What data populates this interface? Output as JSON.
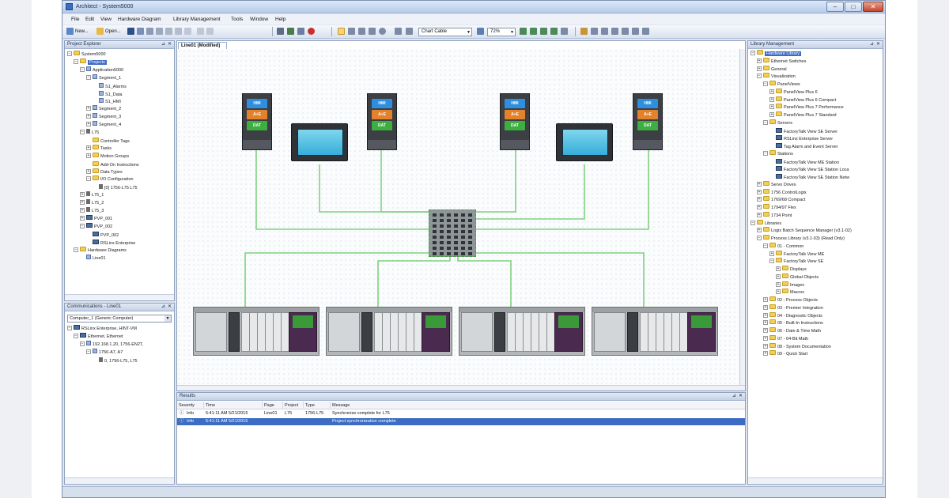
{
  "window": {
    "title": "Architect - System5000",
    "controls": {
      "minimize": "–",
      "maximize": "□",
      "close": "✕"
    }
  },
  "menu": [
    "File",
    "Edit",
    "View",
    "Hardware Diagram",
    "Library Management",
    "Tools",
    "Window",
    "Help"
  ],
  "toolbar": {
    "new_label": "New...",
    "open_label": "Open...",
    "link_style": "Chart Cable",
    "zoom": "72%"
  },
  "project_explorer": {
    "title": "Project Explorer",
    "items": [
      {
        "label": "System5000",
        "expander": "−",
        "icon": "folder-icon"
      },
      {
        "label": "Projects",
        "expander": "−",
        "icon": "folder-icon",
        "selected": true
      },
      {
        "label": "Application5000",
        "expander": "−",
        "icon": "doc-icon"
      },
      {
        "label": "Segment_1",
        "expander": "−",
        "icon": "doc-icon"
      },
      {
        "label": "S1_Alarms",
        "expander": "",
        "icon": "doc-icon"
      },
      {
        "label": "S1_Data",
        "expander": "",
        "icon": "doc-icon"
      },
      {
        "label": "S1_HMI",
        "expander": "",
        "icon": "doc-icon"
      },
      {
        "label": "Segment_2",
        "expander": "+",
        "icon": "doc-icon"
      },
      {
        "label": "Segment_3",
        "expander": "+",
        "icon": "doc-icon"
      },
      {
        "label": "Segment_4",
        "expander": "+",
        "icon": "doc-icon"
      },
      {
        "label": "L75",
        "expander": "−",
        "icon": "tag-icon"
      },
      {
        "label": "Controller Tags",
        "expander": "",
        "icon": "folder-icon"
      },
      {
        "label": "Tasks",
        "expander": "+",
        "icon": "folder-icon"
      },
      {
        "label": "Motion Groups",
        "expander": "+",
        "icon": "folder-icon"
      },
      {
        "label": "Add-On Instructions",
        "expander": "",
        "icon": "folder-icon"
      },
      {
        "label": "Data Types",
        "expander": "+",
        "icon": "folder-icon"
      },
      {
        "label": "I/O Configuration",
        "expander": "−",
        "icon": "folder-icon"
      },
      {
        "label": "[0] 1756-L75 L75",
        "expander": "",
        "icon": "tag-icon"
      },
      {
        "label": "L75_1",
        "expander": "+",
        "icon": "tag-icon"
      },
      {
        "label": "L75_2",
        "expander": "+",
        "icon": "tag-icon"
      },
      {
        "label": "L75_3",
        "expander": "+",
        "icon": "tag-icon"
      },
      {
        "label": "PVP_001",
        "expander": "+",
        "icon": "screen-icon"
      },
      {
        "label": "PVP_002",
        "expander": "−",
        "icon": "screen-icon"
      },
      {
        "label": "PVP_002",
        "expander": "",
        "icon": "screen-icon"
      },
      {
        "label": "RSLinx Enterprise",
        "expander": "",
        "icon": "screen-icon"
      },
      {
        "label": "Hardware Diagrams",
        "expander": "−",
        "icon": "folder-icon"
      },
      {
        "label": "Line01",
        "expander": "",
        "icon": "doc-icon"
      }
    ]
  },
  "communications": {
    "title": "Communications - Line01",
    "computer": "Computer_1 (Generic Computer)",
    "items": [
      {
        "label": "RSLinx Enterprise, HINT-VM",
        "expander": "−",
        "icon": "screen-icon"
      },
      {
        "label": "Ethernet, Ethernet",
        "expander": "−",
        "icon": "screen-icon"
      },
      {
        "label": "192.168.1.20, 1756-EN2T,",
        "expander": "−",
        "icon": "doc-icon"
      },
      {
        "label": "1756-A7, A7",
        "expander": "−",
        "icon": "doc-icon"
      },
      {
        "label": "0, 1756-L75, L75",
        "expander": "",
        "icon": "tag-icon"
      }
    ]
  },
  "diagram": {
    "tab": "Line01 (Modified)",
    "controller_labels": {
      "hmi": "HMI",
      "ae": "A+E",
      "dat": "DAT"
    }
  },
  "results": {
    "title": "Results",
    "columns": [
      "Severity",
      "Time",
      "Page",
      "Project",
      "Type",
      "Message"
    ],
    "rows": [
      {
        "severity": "Info",
        "time": "5:41:11 AM 5/21/2015",
        "page": "Line01",
        "project": "L75",
        "type": "1756-L75",
        "message": "Synchronize complete for L75"
      },
      {
        "severity": "Info",
        "time": "5:41:11 AM 5/21/2015",
        "page": "",
        "project": "",
        "type": "",
        "message": "Project synchronization complete"
      }
    ]
  },
  "library": {
    "title": "Library Management",
    "items": [
      {
        "label": "Hardware Library",
        "expander": "−",
        "icon": "folder-icon",
        "selected": true
      },
      {
        "label": "Ethernet Switches",
        "expander": "+",
        "icon": "folder-icon"
      },
      {
        "label": "General",
        "expander": "+",
        "icon": "folder-icon"
      },
      {
        "label": "Visualization",
        "expander": "−",
        "icon": "folder-icon"
      },
      {
        "label": "PanelViews",
        "expander": "−",
        "icon": "folder-icon"
      },
      {
        "label": "PanelView Plus 6",
        "expander": "+",
        "icon": "folder-icon"
      },
      {
        "label": "PanelView Plus 6 Compact",
        "expander": "+",
        "icon": "folder-icon"
      },
      {
        "label": "PanelView Plus 7 Performance",
        "expander": "+",
        "icon": "folder-icon"
      },
      {
        "label": "PanelView Plus 7 Standard",
        "expander": "+",
        "icon": "folder-icon"
      },
      {
        "label": "Servers",
        "expander": "−",
        "icon": "folder-icon"
      },
      {
        "label": "FactoryTalk View SE Server",
        "expander": "",
        "icon": "screen-icon"
      },
      {
        "label": "RSLinx Enterprise Server",
        "expander": "",
        "icon": "screen-icon"
      },
      {
        "label": "Tag Alarm and Event Server",
        "expander": "",
        "icon": "screen-icon"
      },
      {
        "label": "Stations",
        "expander": "−",
        "icon": "folder-icon"
      },
      {
        "label": "FactoryTalk View ME Station",
        "expander": "",
        "icon": "screen-icon"
      },
      {
        "label": "FactoryTalk View SE Station Loca",
        "expander": "",
        "icon": "screen-icon"
      },
      {
        "label": "FactoryTalk View SE Station Netw",
        "expander": "",
        "icon": "screen-icon"
      },
      {
        "label": "Servo Drives",
        "expander": "+",
        "icon": "folder-icon"
      },
      {
        "label": "1756 ControlLogix",
        "expander": "+",
        "icon": "folder-icon"
      },
      {
        "label": "1769/68 Compact",
        "expander": "+",
        "icon": "folder-icon"
      },
      {
        "label": "1794/97 Flex",
        "expander": "+",
        "icon": "folder-icon"
      },
      {
        "label": "1734 Point",
        "expander": "+",
        "icon": "folder-icon"
      },
      {
        "label": "Libraries",
        "expander": "−",
        "icon": "folder-icon"
      },
      {
        "label": "Logix Batch Sequence Manager (v3.1-02)",
        "expander": "+",
        "icon": "folder-icon"
      },
      {
        "label": "Process Library (v3.1-03) (Read Only)",
        "expander": "−",
        "icon": "folder-icon"
      },
      {
        "label": "01 - Common",
        "expander": "−",
        "icon": "folder-icon"
      },
      {
        "label": "FactoryTalk View ME",
        "expander": "+",
        "icon": "folder-icon"
      },
      {
        "label": "FactoryTalk View SE",
        "expander": "−",
        "icon": "folder-icon"
      },
      {
        "label": "Displays",
        "expander": "+",
        "icon": "folder-icon"
      },
      {
        "label": "Global Objects",
        "expander": "+",
        "icon": "folder-icon"
      },
      {
        "label": "Images",
        "expander": "+",
        "icon": "folder-icon"
      },
      {
        "label": "Macros",
        "expander": "+",
        "icon": "folder-icon"
      },
      {
        "label": "02 - Process Objects",
        "expander": "+",
        "icon": "folder-icon"
      },
      {
        "label": "03 - Premier Integration",
        "expander": "+",
        "icon": "folder-icon"
      },
      {
        "label": "04 - Diagnostic Objects",
        "expander": "+",
        "icon": "folder-icon"
      },
      {
        "label": "05 - Built-In Instructions",
        "expander": "+",
        "icon": "folder-icon"
      },
      {
        "label": "06 - Date & Time Math",
        "expander": "+",
        "icon": "folder-icon"
      },
      {
        "label": "07 - 64-Bit Math",
        "expander": "+",
        "icon": "folder-icon"
      },
      {
        "label": "08 - System Documentation",
        "expander": "+",
        "icon": "folder-icon"
      },
      {
        "label": "09 - Quick Start",
        "expander": "+",
        "icon": "folder-icon"
      }
    ]
  },
  "colors": {
    "accent": "#3d6cc4",
    "link_line": "#7fd27f",
    "hmi": "#2e8fe0",
    "ae": "#e3822a",
    "dat": "#3dae40"
  }
}
